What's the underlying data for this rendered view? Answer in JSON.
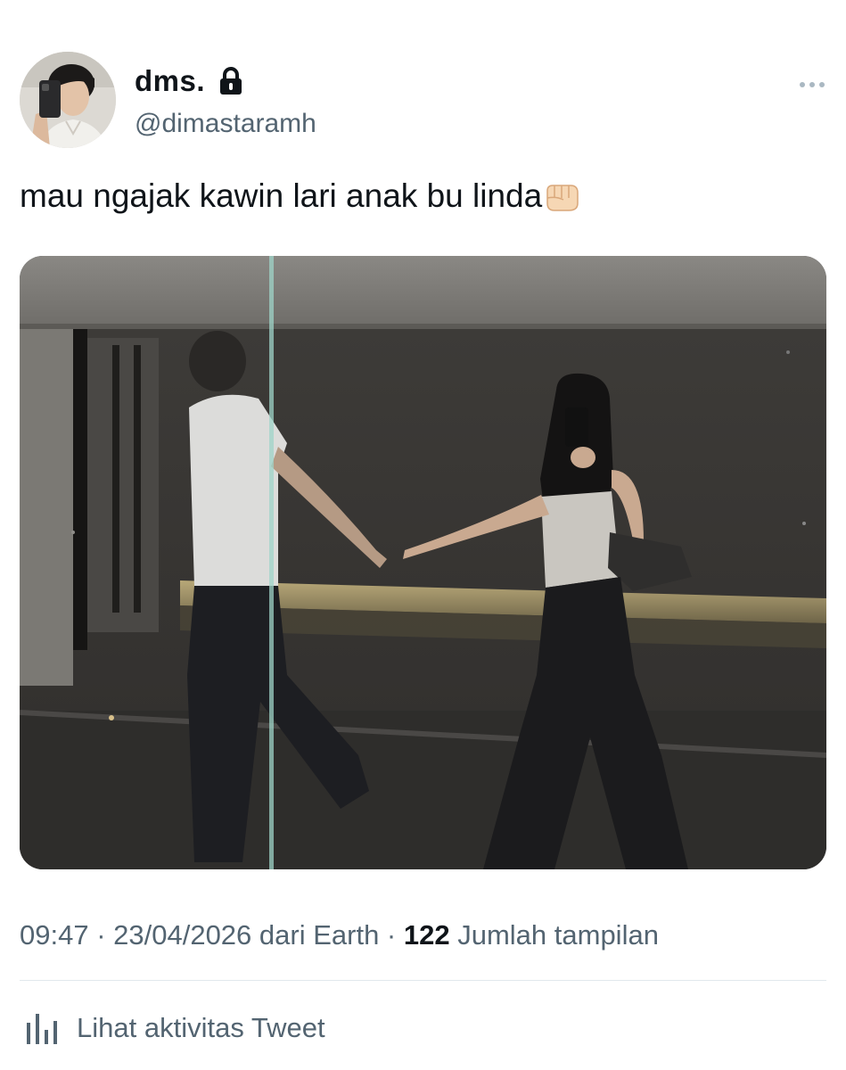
{
  "user": {
    "display_name": "dms.",
    "handle": "@dimastaramh",
    "protected_icon": "lock-icon",
    "avatar_icon": "avatar-photo"
  },
  "tweet": {
    "text": "mau ngajak kawin lari anak bu linda",
    "emoji_icon": "oncoming-fist-icon",
    "media_description_icon": "photo"
  },
  "meta": {
    "time": "09:47",
    "sep1": " · ",
    "date": "23/04/2026",
    "source": " dari Earth",
    "sep2": " · ",
    "views_count": "122",
    "views_label": " Jumlah tampilan"
  },
  "actions": {
    "activity_label": "Lihat aktivitas Tweet",
    "activity_icon": "analytics-bar-icon",
    "more_icon": "more-horizontal-icon"
  },
  "colors": {
    "text_primary": "#0f1419",
    "text_secondary": "#536471",
    "divider": "#e1e8ed"
  }
}
